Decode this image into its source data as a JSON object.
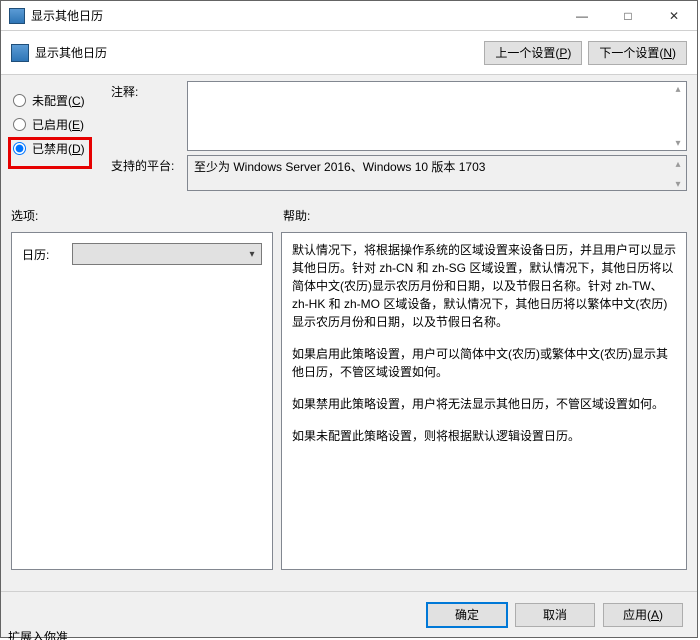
{
  "window": {
    "title": "显示其他日历",
    "minimize_symbol": "—",
    "maximize_symbol": "□",
    "close_symbol": "✕"
  },
  "header": {
    "title": "显示其他日历",
    "prev_label": "上一个设置(",
    "prev_mnemonic": "P",
    "prev_suffix": ")",
    "next_label": "下一个设置(",
    "next_mnemonic": "N",
    "next_suffix": ")"
  },
  "config": {
    "not_configured_label": "未配置(",
    "not_configured_mnemonic": "C",
    "not_configured_suffix": ")",
    "enabled_label": "已启用(",
    "enabled_mnemonic": "E",
    "enabled_suffix": ")",
    "disabled_label": "已禁用(",
    "disabled_mnemonic": "D",
    "disabled_suffix": ")",
    "selected": "disabled",
    "comment_label": "注释:",
    "platform_label": "支持的平台:",
    "platform_text": "至少为 Windows Server 2016、Windows 10 版本 1703"
  },
  "labels": {
    "options": "选项:",
    "help": "帮助:"
  },
  "options": {
    "calendar_label": "日历:",
    "calendar_value": ""
  },
  "help": {
    "p1": "默认情况下，将根据操作系统的区域设置来设备日历，并且用户可以显示其他日历。针对 zh-CN 和 zh-SG 区域设置，默认情况下，其他日历将以简体中文(农历)显示农历月份和日期，以及节假日名称。针对 zh-TW、zh-HK 和 zh-MO 区域设备，默认情况下，其他日历将以繁体中文(农历)显示农历月份和日期，以及节假日名称。",
    "p2": "如果启用此策略设置，用户可以简体中文(农历)或繁体中文(农历)显示其他日历，不管区域设置如何。",
    "p3": "如果禁用此策略设置，用户将无法显示其他日历，不管区域设置如何。",
    "p4": "如果未配置此策略设置，则将根据默认逻辑设置日历。"
  },
  "footer": {
    "ok": "确定",
    "cancel": "取消",
    "apply_label": "应用(",
    "apply_mnemonic": "A",
    "apply_suffix": ")"
  },
  "overflow": {
    "text": "扩展入你准"
  }
}
